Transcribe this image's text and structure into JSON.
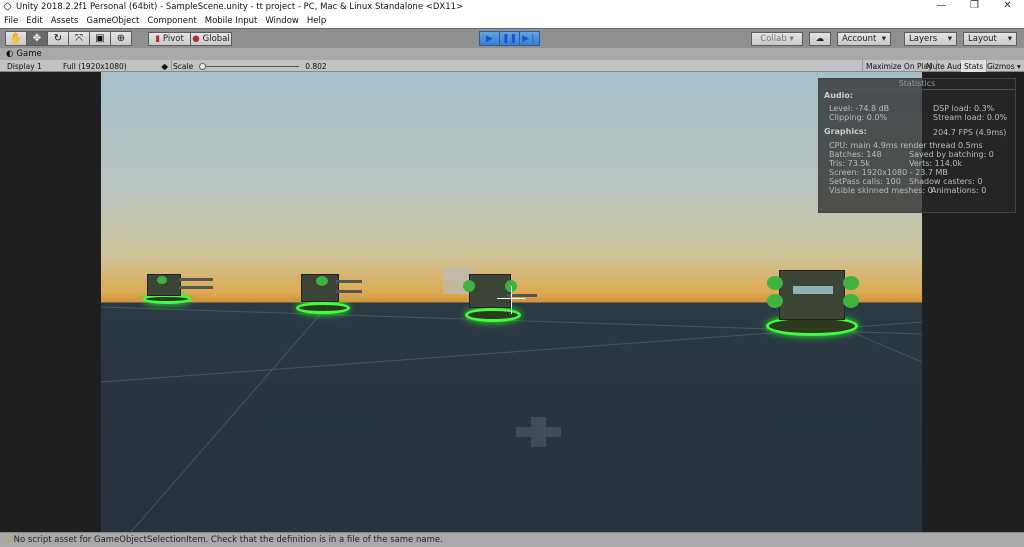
{
  "title": "Unity 2018.2.2f1 Personal (64bit) - SampleScene.unity - tt project - PC, Mac & Linux Standalone <DX11>",
  "window_controls": {
    "minimize": "—",
    "maximize": "❐",
    "close": "✕"
  },
  "menu": [
    "File",
    "Edit",
    "Assets",
    "GameObject",
    "Component",
    "Mobile Input",
    "Window",
    "Help"
  ],
  "toolbar": {
    "tools": [
      "hand-tool",
      "move-tool",
      "rotate-tool",
      "scale-tool",
      "rect-tool",
      "transform-tool"
    ],
    "pivot": "Pivot",
    "global": "Global",
    "collab": "Collab",
    "account": "Account",
    "layers": "Layers",
    "layout": "Layout"
  },
  "tab": {
    "label": "Game"
  },
  "game_toolbar": {
    "display": "Display 1",
    "resolution": "Full (1920x1080)",
    "scale_label": "Scale",
    "scale_value": "0.802",
    "maximize": "Maximize On Play",
    "mute": "Mute Audio",
    "stats": "Stats",
    "gizmos": "Gizmos"
  },
  "stats": {
    "title": "Statistics",
    "audio": "Audio:",
    "level": "Level: -74.8 dB",
    "clipping": "Clipping: 0.0%",
    "dsp": "DSP load: 0.3%",
    "stream": "Stream load: 0.0%",
    "graphics": "Graphics:",
    "fps": "204.7 FPS (4.9ms)",
    "cpu": "CPU: main 4.9ms  render thread 0.5ms",
    "batches": "Batches: 148",
    "saved": "Saved by batching: 0",
    "tris": "Tris: 73.5k",
    "verts": "Verts: 114.0k",
    "screen": "Screen: 1920x1080 - 23.7 MB",
    "setpass": "SetPass calls: 100",
    "shadow": "Shadow casters: 0",
    "skinned": "Visible skinned meshes: 0",
    "animations": "Animations: 0"
  },
  "status": {
    "icon": "warning-icon",
    "message": "No script asset for GameObjectSelectionItem. Check that the definition is in a file of the same name."
  }
}
